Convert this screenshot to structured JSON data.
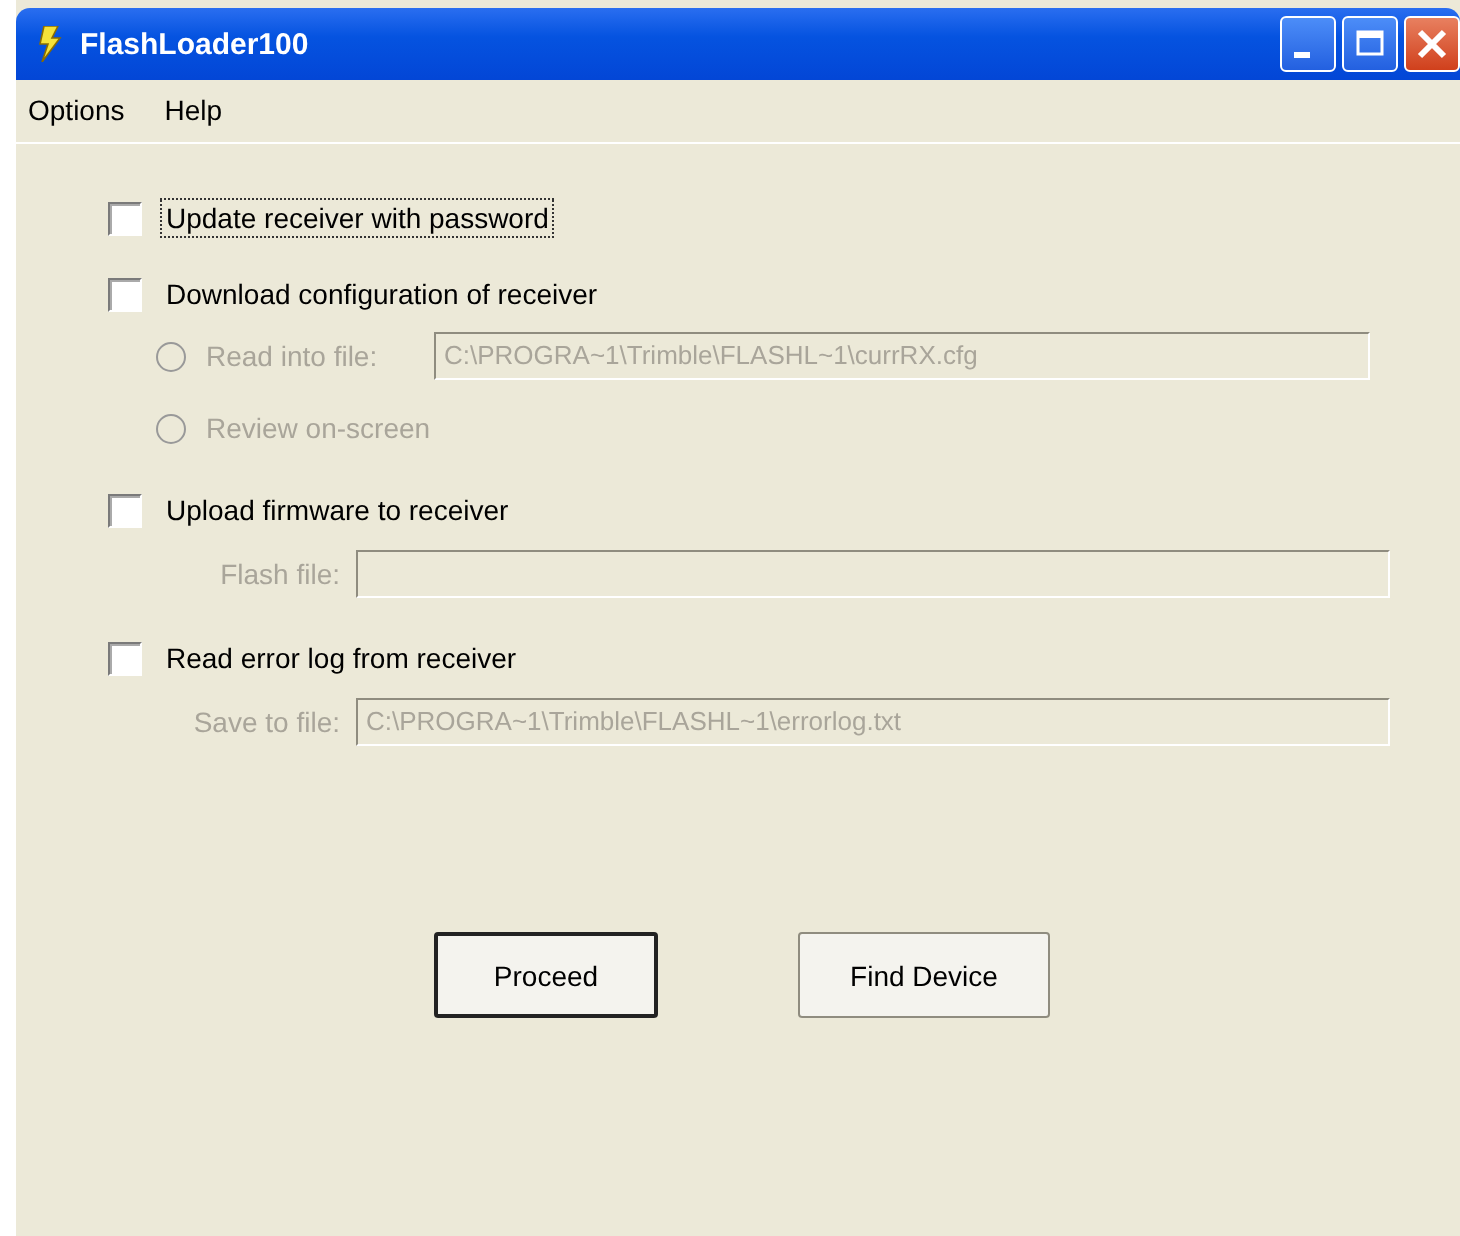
{
  "window": {
    "title": "FlashLoader100"
  },
  "menu": [
    "Options",
    "Help"
  ],
  "rows": [
    {
      "kind": "checkbox",
      "label": "Update receiver with password",
      "checked": false,
      "focused": true,
      "disabled": false
    },
    {
      "kind": "checkbox",
      "label": "Download configuration of receiver",
      "checked": false,
      "focused": false,
      "disabled": false
    },
    {
      "kind": "radio",
      "label": "Read into file:",
      "selected": false,
      "disabled": true,
      "value": "C:\\PROGRA~1\\Trimble\\FLASHL~1\\currRX.cfg"
    },
    {
      "kind": "radio",
      "label": "Review on-screen",
      "selected": false,
      "disabled": true
    },
    {
      "kind": "checkbox",
      "label": "Upload firmware to receiver",
      "checked": false,
      "focused": false,
      "disabled": false
    },
    {
      "kind": "field",
      "label": "Flash file:",
      "disabled": true
    },
    {
      "kind": "checkbox",
      "label": "Read error log from receiver",
      "checked": false,
      "focused": false,
      "disabled": false
    },
    {
      "kind": "field",
      "label": "Save to file:",
      "disabled": true,
      "value": "C:\\PROGRA~1\\Trimble\\FLASHL~1\\errorlog.txt"
    }
  ],
  "buttons": [
    {
      "label": "Proceed",
      "default": true
    },
    {
      "label": "Find Device",
      "default": false
    }
  ]
}
